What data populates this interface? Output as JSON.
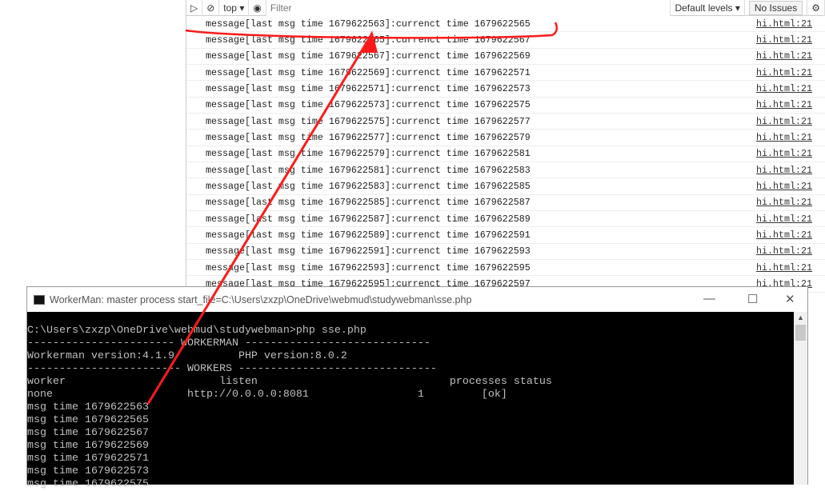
{
  "devtools": {
    "context": "top",
    "filter_placeholder": "Filter",
    "levels": "Default levels",
    "issues": "No Issues",
    "rows": [
      {
        "msg": "message[last msg time 1679622563]:currenct time 1679622565",
        "src": "hi.html:21"
      },
      {
        "msg": "message[last msg time 1679622565]:currenct time 1679622567",
        "src": "hi.html:21"
      },
      {
        "msg": "message[last msg time 1679622567]:currenct time 1679622569",
        "src": "hi.html:21"
      },
      {
        "msg": "message[last msg time 1679622569]:currenct time 1679622571",
        "src": "hi.html:21"
      },
      {
        "msg": "message[last msg time 1679622571]:currenct time 1679622573",
        "src": "hi.html:21"
      },
      {
        "msg": "message[last msg time 1679622573]:currenct time 1679622575",
        "src": "hi.html:21"
      },
      {
        "msg": "message[last msg time 1679622575]:currenct time 1679622577",
        "src": "hi.html:21"
      },
      {
        "msg": "message[last msg time 1679622577]:currenct time 1679622579",
        "src": "hi.html:21"
      },
      {
        "msg": "message[last msg time 1679622579]:currenct time 1679622581",
        "src": "hi.html:21"
      },
      {
        "msg": "message[last msg time 1679622581]:currenct time 1679622583",
        "src": "hi.html:21"
      },
      {
        "msg": "message[last msg time 1679622583]:currenct time 1679622585",
        "src": "hi.html:21"
      },
      {
        "msg": "message[last msg time 1679622585]:currenct time 1679622587",
        "src": "hi.html:21"
      },
      {
        "msg": "message[last msg time 1679622587]:currenct time 1679622589",
        "src": "hi.html:21"
      },
      {
        "msg": "message[last msg time 1679622589]:currenct time 1679622591",
        "src": "hi.html:21"
      },
      {
        "msg": "message[last msg time 1679622591]:currenct time 1679622593",
        "src": "hi.html:21"
      },
      {
        "msg": "message[last msg time 1679622593]:currenct time 1679622595",
        "src": "hi.html:21"
      },
      {
        "msg": "message[last msg time 1679622595]:currenct time 1679622597",
        "src": "hi.html:21"
      }
    ]
  },
  "terminal": {
    "title": "WorkerMan: master process  start_file=C:\\Users\\zxzp\\OneDrive\\webmud\\studywebman\\sse.php",
    "lines": [
      "C:\\Users\\zxzp\\OneDrive\\webmud\\studywebman>php sse.php",
      "----------------------- WORKERMAN -----------------------------",
      "Workerman version:4.1.9          PHP version:8.0.2",
      "------------------------ WORKERS -------------------------------",
      "worker                        listen                              processes status",
      "none                     http://0.0.0.0:8081                 1         [ok]",
      "msg time 1679622563",
      "msg time 1679622565",
      "msg time 1679622567",
      "msg time 1679622569",
      "msg time 1679622571",
      "msg time 1679622573",
      "msg time 1679622575"
    ]
  },
  "colors": {
    "annotation": "#ff1a1a",
    "terminal_bg": "#000000",
    "terminal_fg": "#c0c0c0"
  }
}
